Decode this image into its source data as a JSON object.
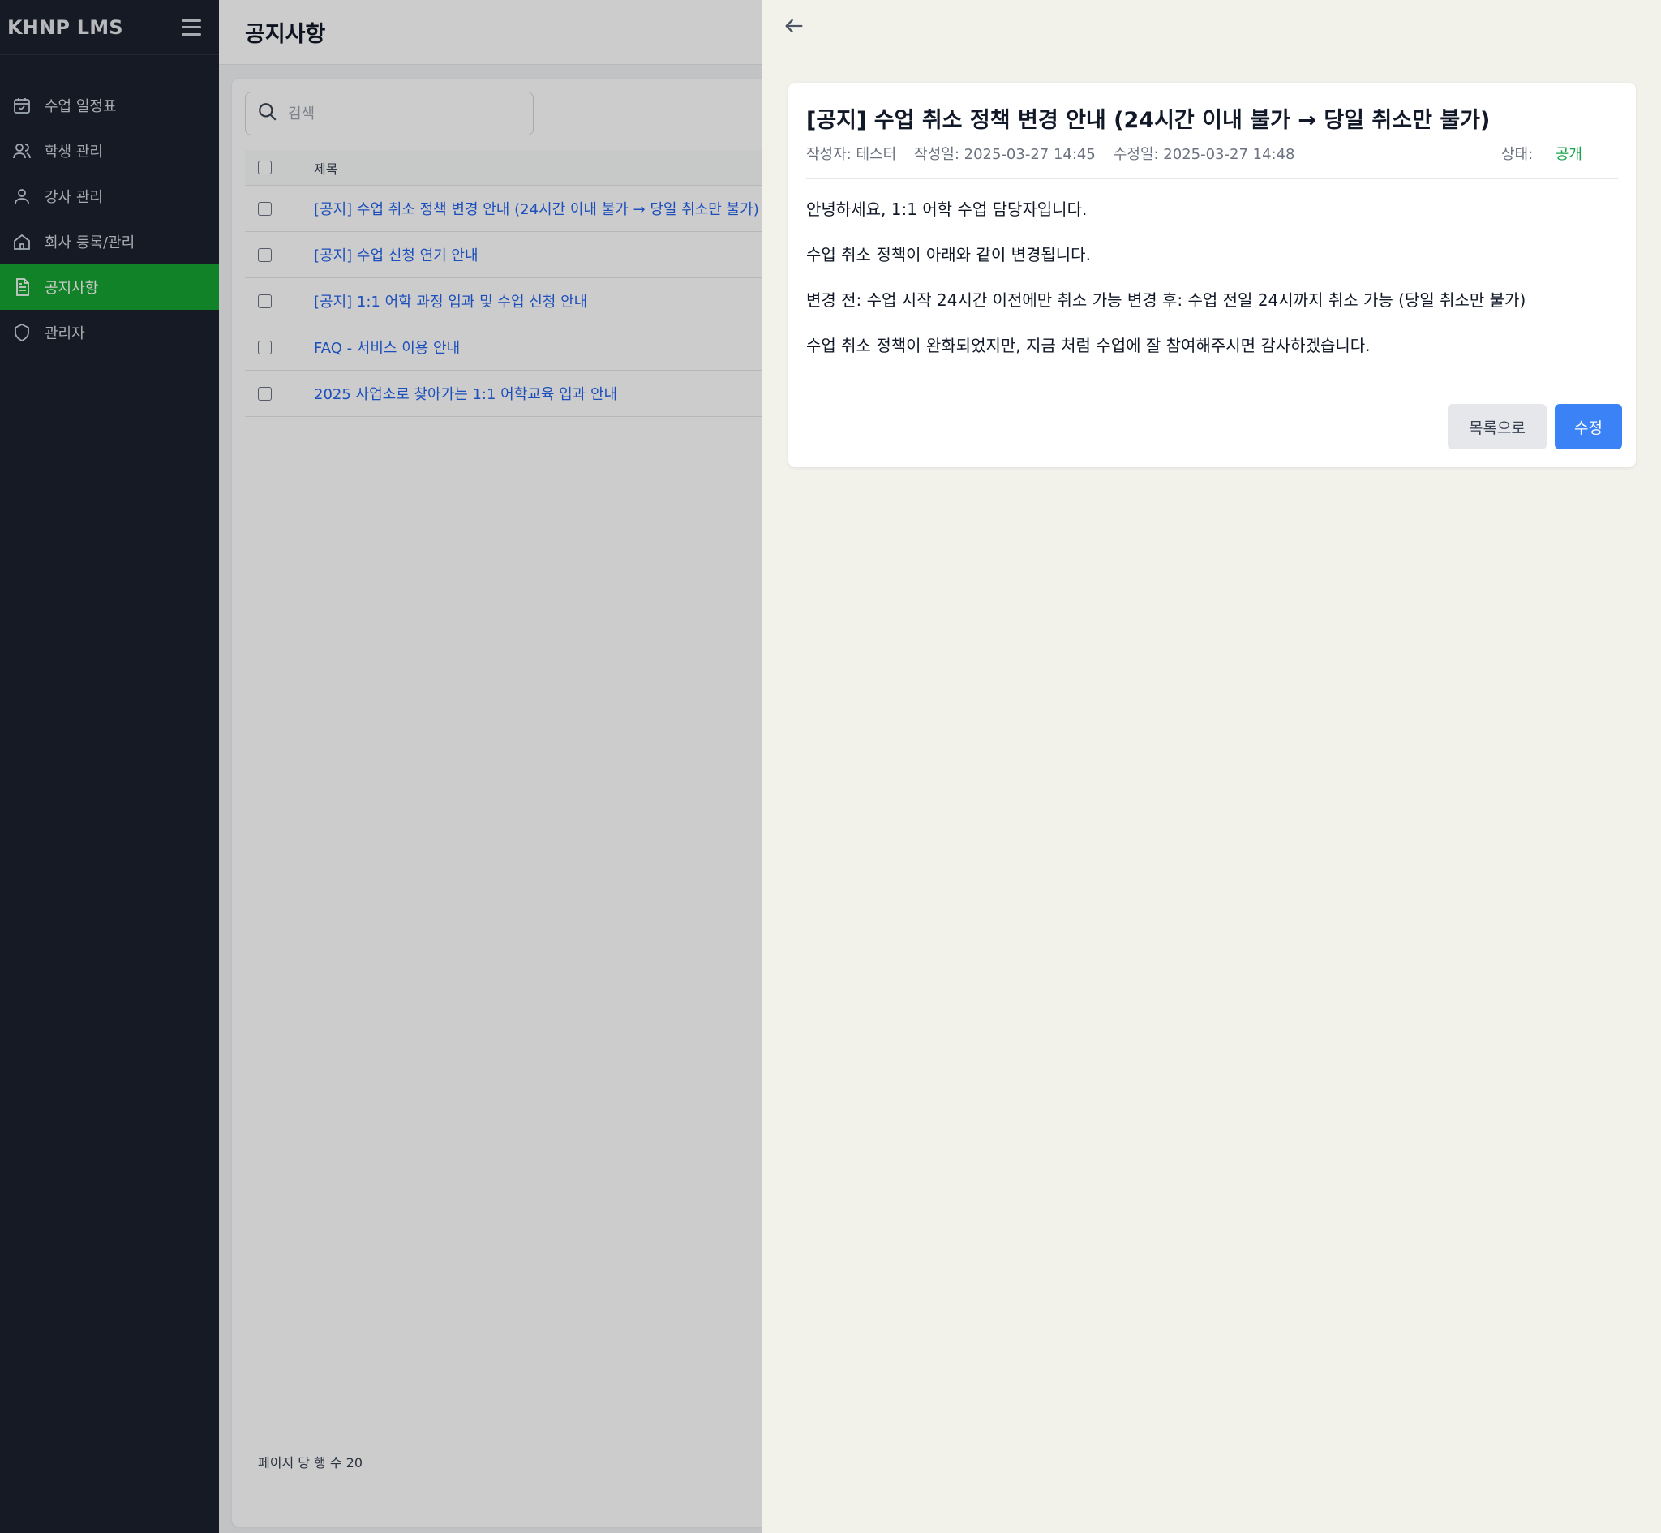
{
  "app": {
    "brand": "KHNP LMS"
  },
  "sidebar": {
    "items": [
      {
        "label": "수업 일정표",
        "icon": "calendar-icon"
      },
      {
        "label": "학생 관리",
        "icon": "users-icon"
      },
      {
        "label": "강사 관리",
        "icon": "user-icon"
      },
      {
        "label": "회사 등록/관리",
        "icon": "home-icon"
      },
      {
        "label": "공지사항",
        "icon": "document-icon",
        "active": true
      },
      {
        "label": "관리자",
        "icon": "shield-icon"
      }
    ],
    "active_color": "#16a332"
  },
  "main": {
    "title": "공지사항",
    "search": {
      "placeholder": "검색",
      "value": ""
    },
    "table": {
      "header": "제목",
      "rows": [
        "[공지] 수업 취소 정책 변경 안내 (24시간 이내 불가 → 당일 취소만 불가)",
        "[공지] 수업 신청 연기 안내",
        "[공지] 1:1 어학 과정 입과 및 수업 신청 안내",
        "FAQ - 서비스 이용 안내",
        "2025 사업소로 찾아가는 1:1 어학교육 입과 안내"
      ]
    },
    "footer": {
      "rows_per_page": "페이지 당 행 수 20"
    }
  },
  "detail": {
    "title": "[공지] 수업 취소 정책 변경 안내 (24시간 이내 불가 → 당일 취소만 불가)",
    "meta": {
      "author": "작성자: 테스터",
      "created": "작성일: 2025-03-27 14:45",
      "modified": "수정일: 2025-03-27 14:48",
      "status_label": "상태: ",
      "status_value": "공개"
    },
    "body": [
      "안녕하세요, 1:1 어학 수업 담당자입니다.",
      "수업 취소 정책이 아래와 같이 변경됩니다.",
      "변경 전: 수업 시작 24시간 이전에만 취소 가능 변경 후: 수업 전일 24시까지 취소 가능 (당일 취소만 불가)",
      "수업 취소 정책이 완화되었지만, 지금 처럼 수업에 잘 참여해주시면 감사하겠습니다."
    ],
    "buttons": {
      "list": "목록으로",
      "edit": "수정"
    },
    "colors": {
      "status": "#16a34a",
      "primary": "#3b82f6"
    }
  }
}
